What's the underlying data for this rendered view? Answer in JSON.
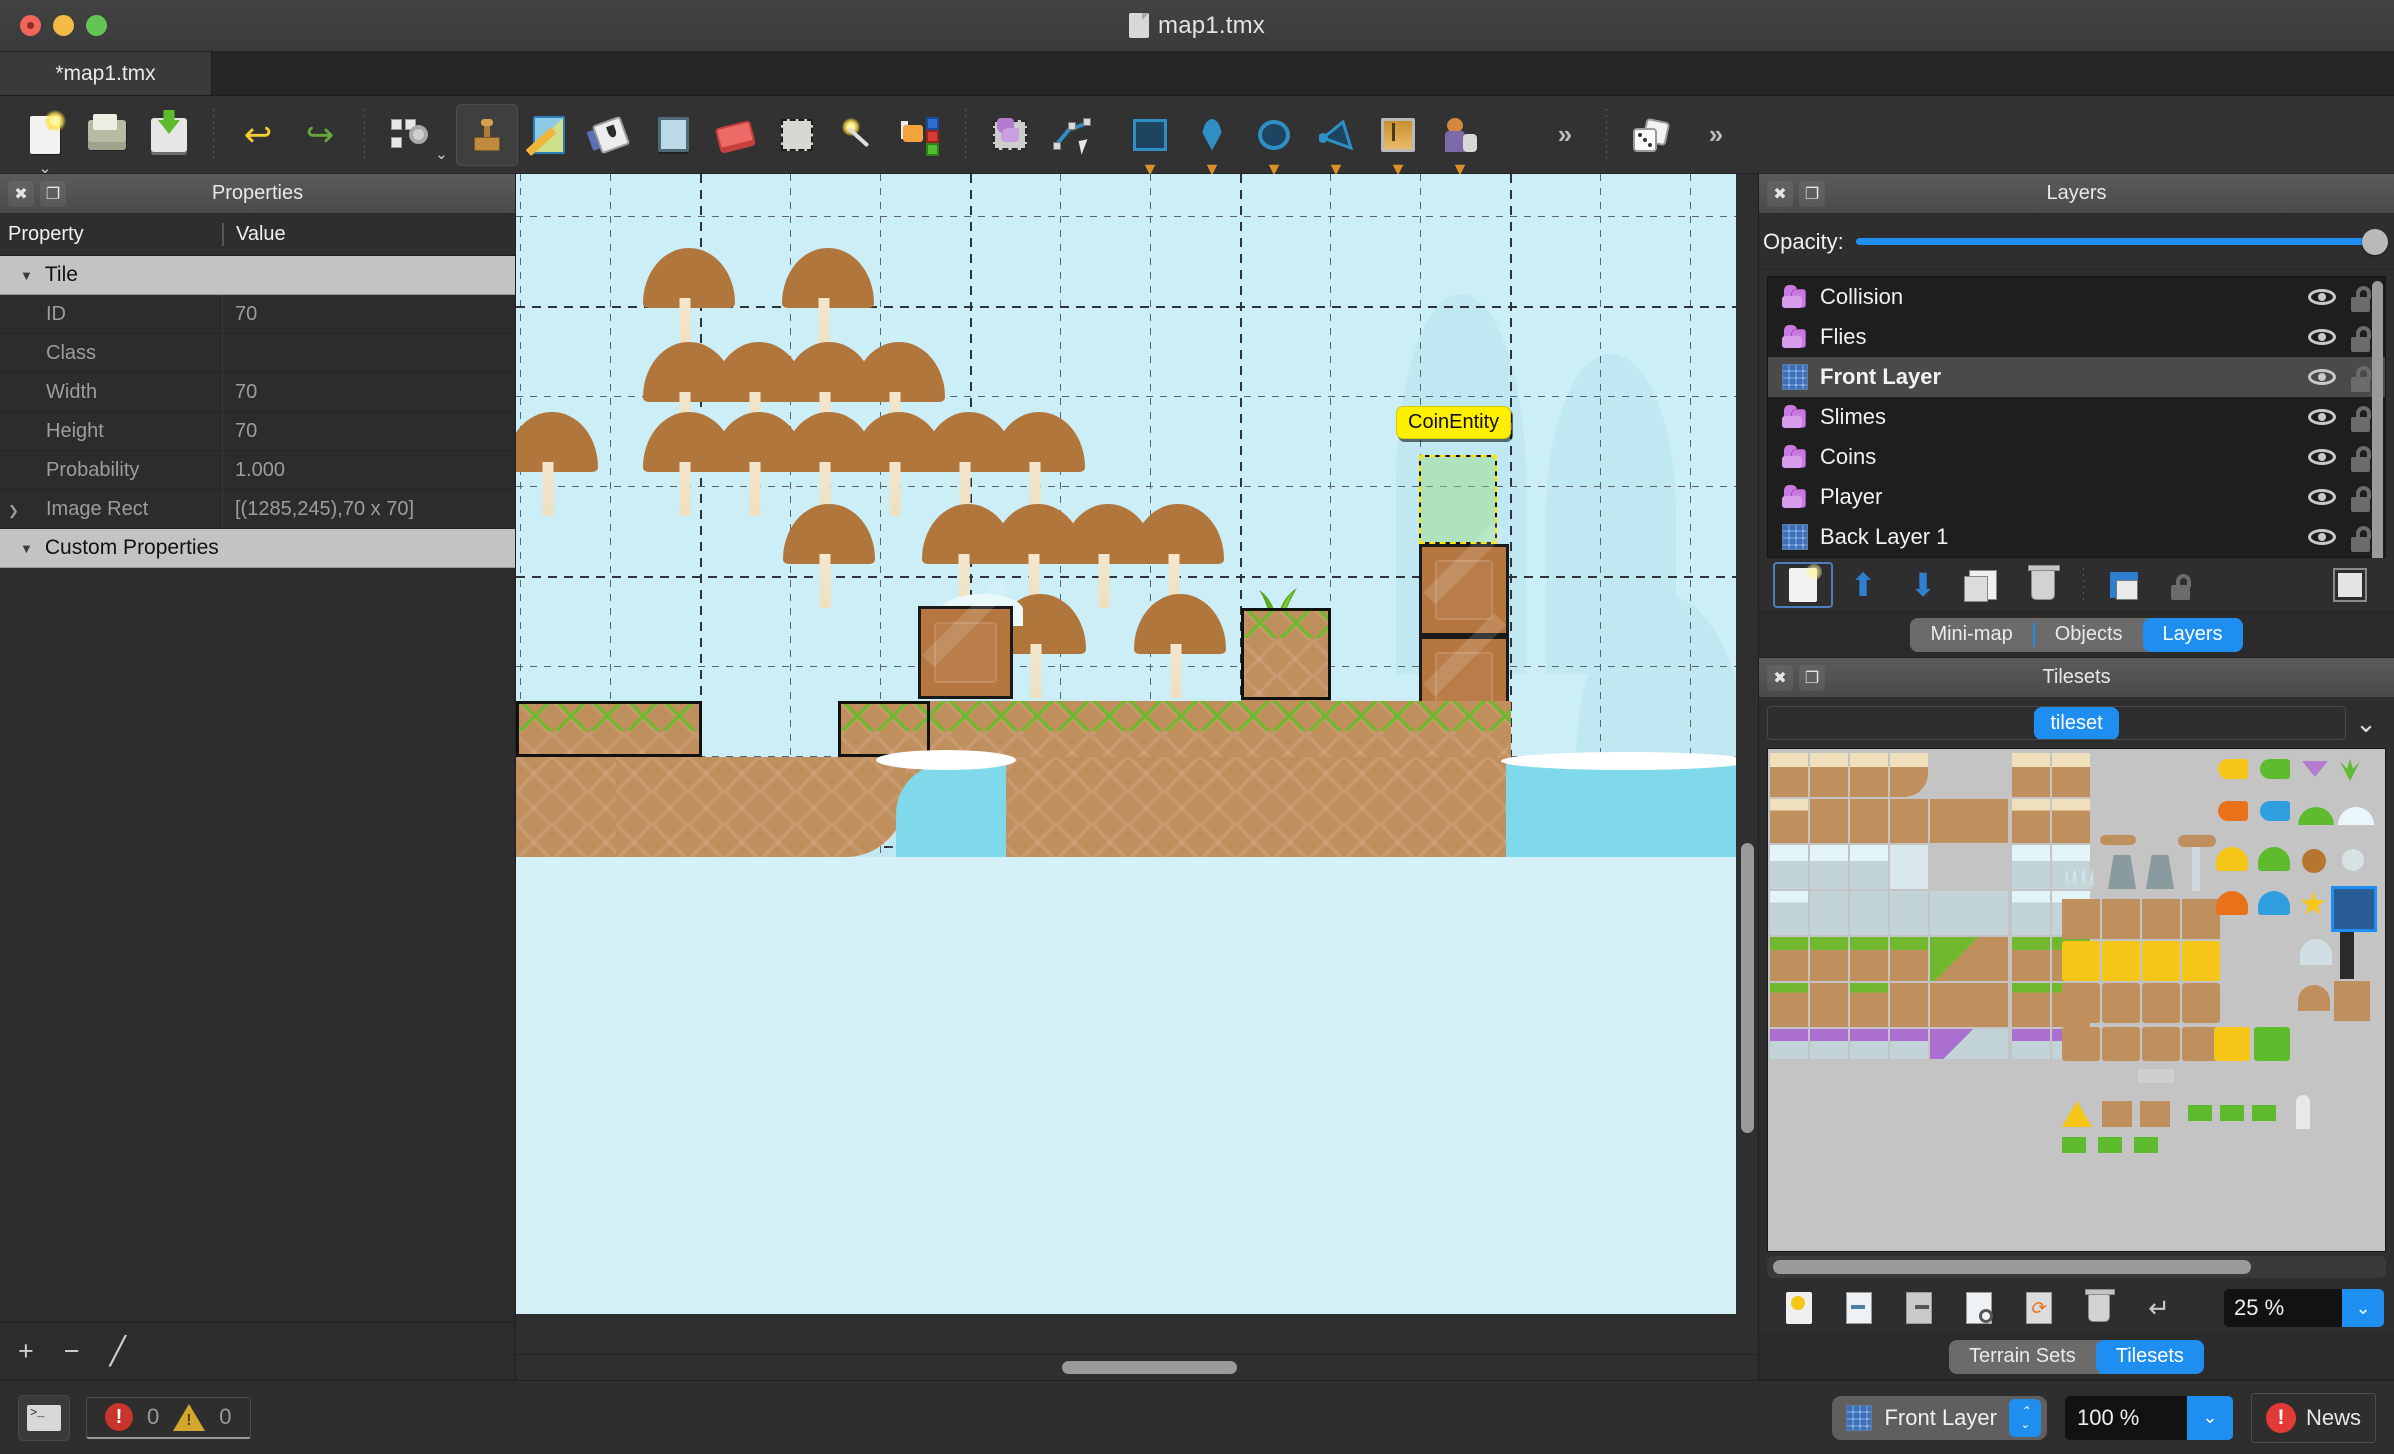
{
  "window": {
    "title": "map1.tmx",
    "traffic_lights": [
      "close",
      "minimize",
      "zoom"
    ]
  },
  "document_tab": {
    "label": "*map1.tmx"
  },
  "toolbar": {
    "items": [
      {
        "name": "new-map-button",
        "icon": "new-file-icon",
        "label": "New Map",
        "has_dropdown": true
      },
      {
        "name": "open-file-button",
        "icon": "folder-open-icon",
        "label": "Open"
      },
      {
        "name": "save-button",
        "icon": "save-disk-icon",
        "label": "Save"
      },
      {
        "name": "undo-button",
        "icon": "undo-arrow-icon",
        "label": "Undo"
      },
      {
        "name": "redo-button",
        "icon": "redo-arrow-icon",
        "label": "Redo"
      },
      {
        "name": "map-properties-button",
        "icon": "map-gear-icon",
        "label": "Map Properties",
        "has_dropdown": true
      },
      {
        "name": "stamp-brush-tool",
        "icon": "stamp-icon",
        "label": "Stamp Brush",
        "active": true
      },
      {
        "name": "terrain-brush-tool",
        "icon": "terrain-brush-icon",
        "label": "Terrain Brush"
      },
      {
        "name": "bucket-fill-tool",
        "icon": "bucket-fill-icon",
        "label": "Bucket Fill"
      },
      {
        "name": "shape-fill-tool",
        "icon": "shape-fill-icon",
        "label": "Shape Fill"
      },
      {
        "name": "eraser-tool",
        "icon": "eraser-icon",
        "label": "Eraser"
      },
      {
        "name": "rectangular-select-tool",
        "icon": "rectangular-select-icon",
        "label": "Rectangular Select"
      },
      {
        "name": "magic-wand-tool",
        "icon": "magic-wand-icon",
        "label": "Magic Wand"
      },
      {
        "name": "select-same-tile-tool",
        "icon": "select-same-tile-icon",
        "label": "Select Same Tile"
      },
      {
        "name": "select-objects-tool",
        "icon": "select-objects-icon",
        "label": "Select Objects"
      },
      {
        "name": "edit-polygons-tool",
        "icon": "edit-polygons-icon",
        "label": "Edit Polygons"
      },
      {
        "name": "insert-rectangle-tool",
        "icon": "rectangle-object-icon",
        "label": "Insert Rectangle",
        "has_dropdown": true
      },
      {
        "name": "insert-point-tool",
        "icon": "point-object-icon",
        "label": "Insert Point",
        "has_dropdown": true
      },
      {
        "name": "insert-ellipse-tool",
        "icon": "ellipse-object-icon",
        "label": "Insert Ellipse",
        "has_dropdown": true
      },
      {
        "name": "insert-polygon-tool",
        "icon": "polygon-object-icon",
        "label": "Insert Polygon",
        "has_dropdown": true
      },
      {
        "name": "insert-image-tool",
        "icon": "image-object-icon",
        "label": "Insert Image",
        "has_dropdown": true
      },
      {
        "name": "insert-template-tool",
        "icon": "insert-template-icon",
        "label": "Insert Template",
        "has_dropdown": true
      },
      {
        "name": "toolbar-overflow-button",
        "icon": "double-chevron-right-icon",
        "label": "More"
      },
      {
        "name": "randomize-button",
        "icon": "dice-icon",
        "label": "Random Mode"
      },
      {
        "name": "toolbar-overflow-button-2",
        "icon": "double-chevron-right-icon",
        "label": "More"
      }
    ]
  },
  "properties_panel": {
    "title": "Properties",
    "close_label": "✖",
    "float_label": "⧉",
    "columns": [
      "Property",
      "Value"
    ],
    "groups": [
      {
        "name": "Tile",
        "expanded": true,
        "rows": [
          {
            "property": "ID",
            "value": "70",
            "expandable": false
          },
          {
            "property": "Class",
            "value": "",
            "expandable": false
          },
          {
            "property": "Width",
            "value": "70",
            "expandable": false
          },
          {
            "property": "Height",
            "value": "70",
            "expandable": false
          },
          {
            "property": "Probability",
            "value": "1.000",
            "expandable": false
          },
          {
            "property": "Image Rect",
            "value": "[(1285,245),70 x 70]",
            "expandable": true
          }
        ]
      },
      {
        "name": "Custom Properties",
        "expanded": true,
        "rows": []
      }
    ],
    "footer_buttons": [
      {
        "name": "add-property-button",
        "glyph": "+"
      },
      {
        "name": "remove-property-button",
        "glyph": "−"
      },
      {
        "name": "edit-property-button",
        "glyph": "╱"
      }
    ]
  },
  "layers_panel": {
    "title": "Layers",
    "opacity_label": "Opacity:",
    "opacity_value": 100,
    "layers": [
      {
        "name": "Collision",
        "type": "object",
        "visible": true,
        "locked": false,
        "selected": false
      },
      {
        "name": "Flies",
        "type": "object",
        "visible": true,
        "locked": false,
        "selected": false
      },
      {
        "name": "Front Layer",
        "type": "tile",
        "visible": true,
        "locked": false,
        "selected": true
      },
      {
        "name": "Slimes",
        "type": "object",
        "visible": true,
        "locked": false,
        "selected": false
      },
      {
        "name": "Coins",
        "type": "object",
        "visible": true,
        "locked": false,
        "selected": false
      },
      {
        "name": "Player",
        "type": "object",
        "visible": true,
        "locked": false,
        "selected": false
      },
      {
        "name": "Back Layer 1",
        "type": "tile",
        "visible": true,
        "locked": false,
        "selected": false
      }
    ],
    "toolbar": [
      {
        "name": "new-layer-button",
        "icon": "new-layer-icon"
      },
      {
        "name": "move-layer-up-button",
        "icon": "arrow-up-icon"
      },
      {
        "name": "move-layer-down-button",
        "icon": "arrow-down-icon"
      },
      {
        "name": "duplicate-layer-button",
        "icon": "duplicate-layer-icon"
      },
      {
        "name": "delete-layer-button",
        "icon": "trash-icon"
      },
      {
        "name": "toggle-other-layers-button",
        "icon": "layers-stack-icon"
      },
      {
        "name": "lock-other-layers-button",
        "icon": "lock-icon"
      },
      {
        "name": "highlight-current-layer-button",
        "icon": "highlight-square-icon"
      }
    ],
    "tabs": [
      {
        "label": "Mini-map",
        "selected": false
      },
      {
        "label": "Objects",
        "selected": false
      },
      {
        "label": "Layers",
        "selected": true
      }
    ]
  },
  "tilesets_panel": {
    "title": "Tilesets",
    "active_tileset": "tileset",
    "dropdown_icon": "chevron-down-icon",
    "zoom": "25 %",
    "toolbar": [
      {
        "name": "new-tileset-button",
        "icon": "new-tileset-icon"
      },
      {
        "name": "embed-tileset-button",
        "icon": "embed-tileset-icon"
      },
      {
        "name": "export-tileset-button",
        "icon": "export-tileset-icon"
      },
      {
        "name": "edit-tileset-button",
        "icon": "edit-tileset-icon"
      },
      {
        "name": "replace-tileset-button",
        "icon": "replace-tileset-icon"
      },
      {
        "name": "remove-tileset-button",
        "icon": "trash-icon"
      },
      {
        "name": "dynamic-wrapping-button",
        "icon": "wrap-arrow-icon"
      }
    ],
    "tabs": [
      {
        "label": "Terrain Sets",
        "selected": false
      },
      {
        "label": "Tilesets",
        "selected": true
      }
    ]
  },
  "canvas": {
    "objects": [
      {
        "name": "CoinEntity",
        "label": "CoinEntity"
      }
    ]
  },
  "statusbar": {
    "terminal_button": "console-icon",
    "error_icon": "error-icon",
    "error_count": "0",
    "warning_icon": "warning-icon",
    "warning_count": "0",
    "current_layer": "Front Layer",
    "current_layer_icon": "tile-layer-icon",
    "zoom": "100 %",
    "news_label": "News",
    "news_icon": "alert-icon"
  },
  "colors": {
    "accent": "#1f8ef1",
    "panel_bg": "#2e2e2e",
    "canvas_sky": "#cbeef7",
    "object_label_bg": "#ffef00",
    "error": "#c9342d",
    "warning": "#d3a72b"
  }
}
